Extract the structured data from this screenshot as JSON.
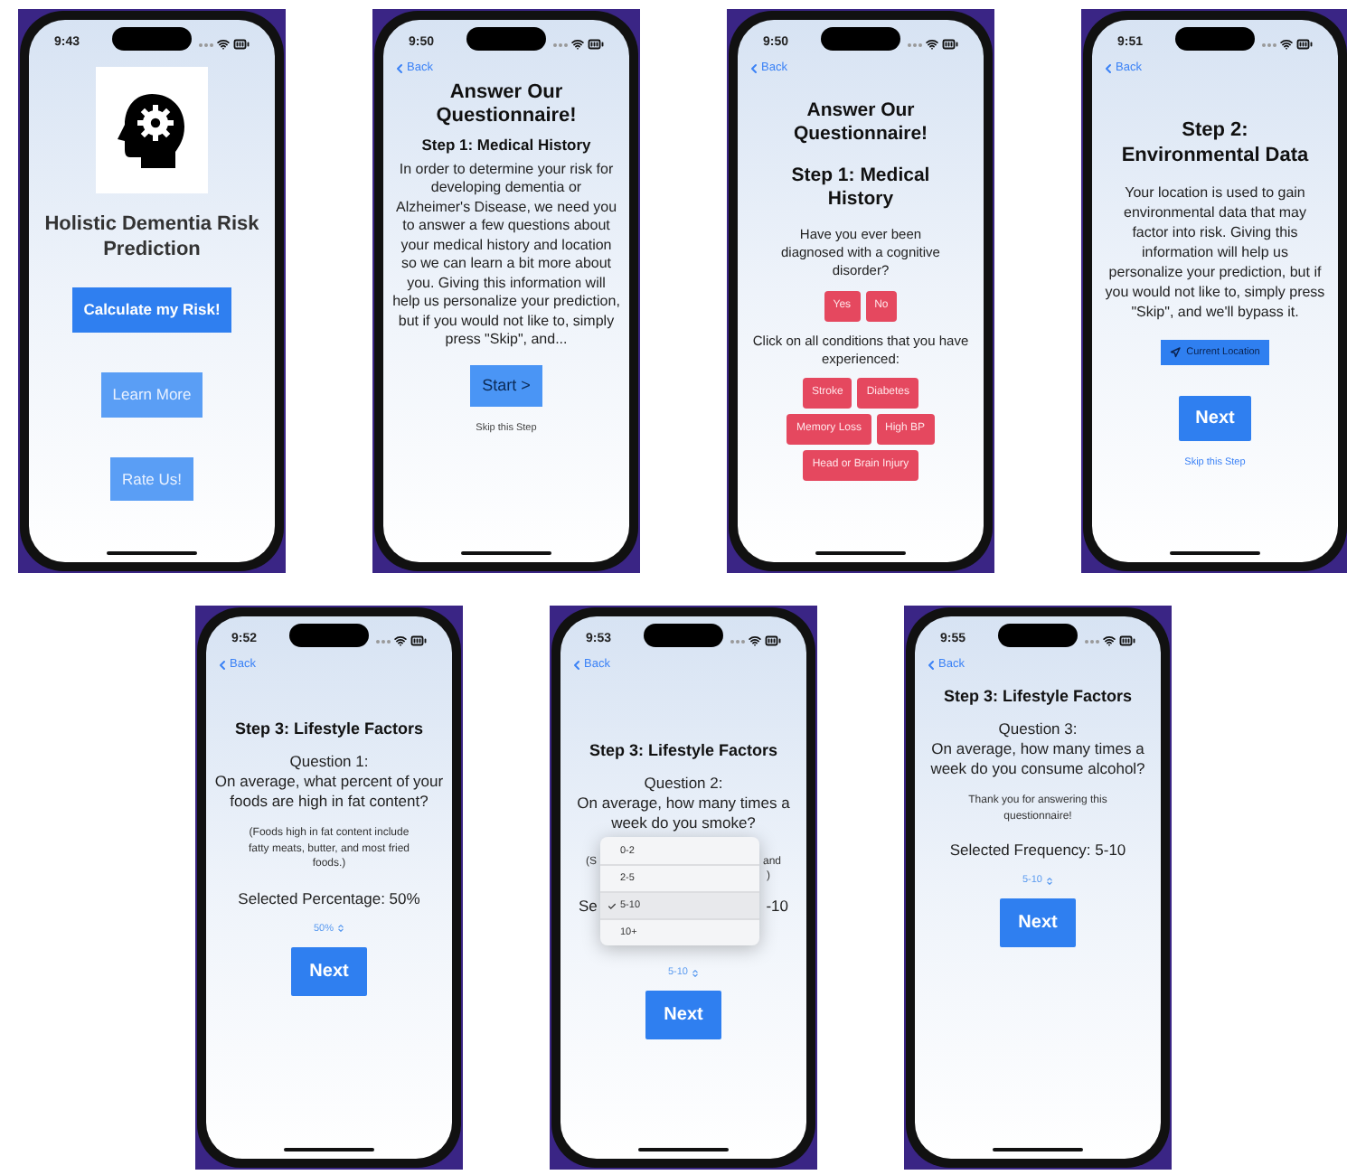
{
  "screens": [
    {
      "kind": "home",
      "time": "9:43",
      "title": "Holistic Dementia Risk Prediction",
      "buttons": [
        {
          "label": "Calculate my Risk!",
          "primary": true
        },
        {
          "label": "Learn More",
          "primary": false
        },
        {
          "label": "Rate Us!",
          "primary": false
        }
      ]
    },
    {
      "kind": "intro",
      "time": "9:50",
      "back": "Back",
      "title": "Answer Our Questionnaire!",
      "subtitle": "Step 1: Medical History",
      "body": "In order to determine your risk for developing dementia or Alzheimer's Disease, we need you to answer a few questions about your medical history and location so we can learn a bit more about you. Giving this information will help us personalize your prediction, but if you would not like to, simply press \"Skip\", and...",
      "button": "Start >",
      "skip": "Skip this Step"
    },
    {
      "kind": "medical",
      "time": "9:50",
      "back": "Back",
      "title": "Answer Our Questionnaire!",
      "subtitle": "Step 1: Medical History",
      "question": "Have you ever been diagnosed with a cognitive disorder?",
      "answers": [
        "Yes",
        "No"
      ],
      "prompt": "Click on all conditions that you have experienced:",
      "conditions": [
        "Stroke",
        "Diabetes",
        "Memory Loss",
        "High BP",
        "Head or Brain Injury"
      ]
    },
    {
      "kind": "environment",
      "time": "9:51",
      "back": "Back",
      "title": "Step 2: Environmental Data",
      "body": "Your location is used to gain environmental data that may factor into risk. Giving this information will help us personalize your prediction, but if you would not like to, simply press \"Skip\", and we'll bypass it.",
      "location": "Current Location",
      "button": "Next",
      "skip": "Skip this Step"
    },
    {
      "kind": "question",
      "time": "9:52",
      "back": "Back",
      "title": "Step 3: Lifestyle Factors",
      "question_label": "Question 1:",
      "question": "On average, what percent of your foods are high in fat content?",
      "note": "(Foods high in fat content include fatty meats, butter, and most fried foods.)",
      "selected": "Selected Percentage: 50%",
      "picker": "50%",
      "button": "Next"
    },
    {
      "kind": "menu",
      "time": "9:53",
      "back": "Back",
      "title": "Step 3: Lifestyle Factors",
      "question_label": "Question 2:",
      "question": "On average, how many times a week do you smoke?",
      "note_fragments": [
        "(S",
        "and",
        ")"
      ],
      "selected_fragments": [
        "Se",
        "-10"
      ],
      "options": [
        {
          "label": "0-2",
          "selected": false
        },
        {
          "label": "2-5",
          "selected": false
        },
        {
          "label": "5-10",
          "selected": true
        },
        {
          "label": "10+",
          "selected": false
        }
      ],
      "picker": "5-10",
      "button": "Next"
    },
    {
      "kind": "question",
      "time": "9:55",
      "back": "Back",
      "title": "Step 3: Lifestyle Factors",
      "question_label": "Question 3:",
      "question": "On average, how many times a week do you consume alcohol?",
      "note": "Thank you for answering this questionnaire!",
      "selected": "Selected Frequency: 5-10",
      "picker": "5-10",
      "button": "Next"
    }
  ]
}
